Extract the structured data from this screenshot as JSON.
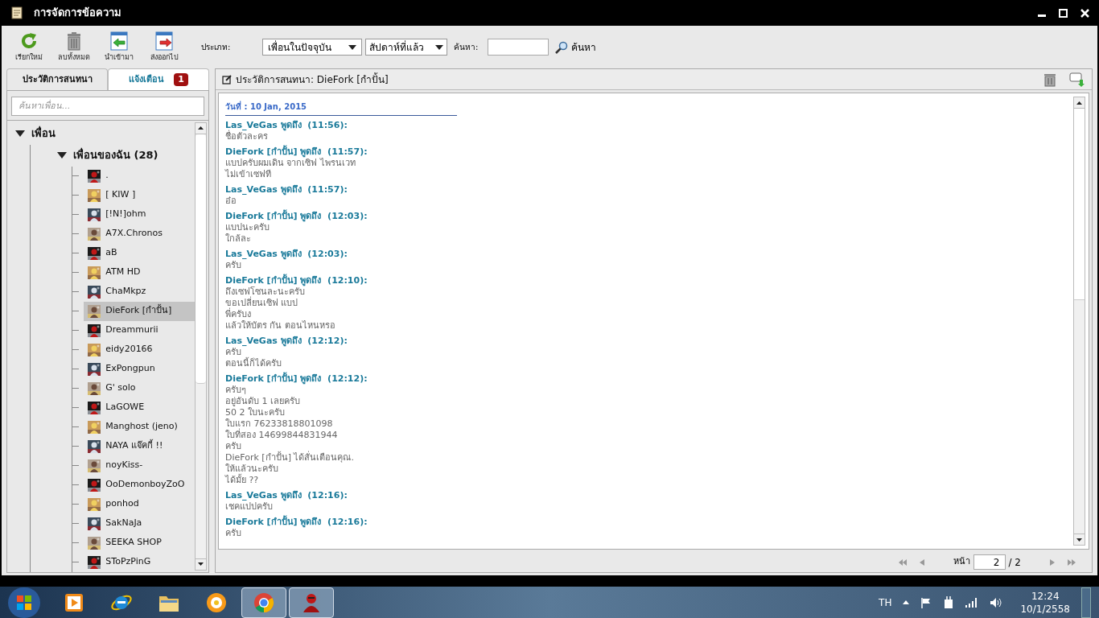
{
  "window": {
    "title": "การจัดการข้อความ"
  },
  "toolbar": {
    "buttons": [
      {
        "kind": "refresh",
        "label": "เรียกใหม่"
      },
      {
        "kind": "delete",
        "label": "ลบทั้งหมด"
      },
      {
        "kind": "import",
        "label": "นำเข้ามา"
      },
      {
        "kind": "export",
        "label": "ส่งออกไป"
      }
    ],
    "type_label": "ประเภท:",
    "type_select": "เพื่อนในปัจจุบัน",
    "period_select": "สัปดาห์ที่แล้ว",
    "search_label": "ค้นหา:",
    "search_button": "ค้นหา"
  },
  "left_tabs": [
    {
      "label": "ประวัติการสนทนา",
      "selected": true
    },
    {
      "label": "แจ้งเตือน",
      "selected": false,
      "badge": "1"
    }
  ],
  "friend_search": {
    "placeholder": "ค้นหาเพื่อน..."
  },
  "tree": [
    {
      "label": "เพื่อน",
      "expanded": true,
      "children": [
        {
          "label": "เพื่อนของฉัน (28)",
          "expanded": true,
          "children": [
            {
              "name": ".",
              "selected": false
            },
            {
              "name": "[ KIW ]",
              "selected": false
            },
            {
              "name": "[!N!]ohm",
              "selected": false
            },
            {
              "name": "A7X.Chronos",
              "selected": false
            },
            {
              "name": "aB",
              "selected": false
            },
            {
              "name": "ATM HD",
              "selected": false
            },
            {
              "name": "ChaMkpz",
              "selected": false
            },
            {
              "name": "DieFork [กำปั้น]",
              "selected": true
            },
            {
              "name": "Dreammurii",
              "selected": false
            },
            {
              "name": "eidy20166",
              "selected": false
            },
            {
              "name": "ExPongpun",
              "selected": false
            },
            {
              "name": "G' solo",
              "selected": false
            },
            {
              "name": "LaGOWE",
              "selected": false
            },
            {
              "name": "Manghost (jeno)",
              "selected": false
            },
            {
              "name": "NAYA แจ๊คกี้ !!",
              "selected": false
            },
            {
              "name": "noyKiss-",
              "selected": false
            },
            {
              "name": "OoDemonboyZoO",
              "selected": false
            },
            {
              "name": "ponhod",
              "selected": false
            },
            {
              "name": "SakNaJa",
              "selected": false
            },
            {
              "name": "SEEKA SHOP",
              "selected": false
            },
            {
              "name": "SToPzPinG",
              "selected": false
            }
          ]
        }
      ]
    }
  ],
  "chat": {
    "title": "ประวัติการสนทนา: DieFork [กำปั้น]",
    "date": "วันที่ : 10 Jan, 2015",
    "messages": [
      {
        "header": "Las_VeGas พูดถึง  (11:56):",
        "lines": [
          "ชื่อตัวละคร"
        ]
      },
      {
        "header": "DieFork [กำปั้น] พูดถึง  (11:57):",
        "lines": [
          "แบปครับผมเดิน จากเซิฟ ไพรนเวท",
          "ไม่เข้าเซฟที"
        ]
      },
      {
        "header": "Las_VeGas พูดถึง  (11:57):",
        "lines": [
          "อ๋อ"
        ]
      },
      {
        "header": "DieFork [กำปั้น] พูดถึง  (12:03):",
        "lines": [
          "แบปนะครับ",
          "ใกล้ละ"
        ]
      },
      {
        "header": "Las_VeGas พูดถึง  (12:03):",
        "lines": [
          "ครับ"
        ]
      },
      {
        "header": "DieFork [กำปั้น] พูดถึง  (12:10):",
        "lines": [
          "ถึงเซฟโซนละนะครับ",
          "ขอเปลี่ยนเซิฟ แบป",
          "พี่ครับง",
          "แล้วให้บัตร กัน ตอนไหนหรอ"
        ]
      },
      {
        "header": "Las_VeGas พูดถึง  (12:12):",
        "lines": [
          "ครับ",
          "ตอนนี้ก็ได้ครับ"
        ]
      },
      {
        "header": "DieFork [กำปั้น] พูดถึง  (12:12):",
        "lines": [
          "ครับๆ",
          "อยู่อันดับ 1 เลยครับ",
          "50 2 ใบนะครับ",
          "ใบแรก 76233818801098",
          "ใบที่สอง 14699844831944",
          "ครับ",
          "DieFork [กำปั้น] ได้สั่นเตือนคุณ.",
          "ให้แล้วนะครับ",
          "ได้มั้ย ??"
        ]
      },
      {
        "header": "Las_VeGas พูดถึง  (12:16):",
        "lines": [
          "เชคแปปครับ"
        ]
      },
      {
        "header": "DieFork [กำปั้น] พูดถึง  (12:16):",
        "lines": [
          "ครับ"
        ]
      }
    ]
  },
  "pager": {
    "label": "หน้า",
    "page": "2",
    "total": "/ 2"
  },
  "taskbar": {
    "apps": [
      {
        "kind": "media",
        "running": false
      },
      {
        "kind": "browser-e",
        "running": false
      },
      {
        "kind": "folder",
        "running": false
      },
      {
        "kind": "orange",
        "running": false
      },
      {
        "kind": "chrome",
        "running": true
      },
      {
        "kind": "app",
        "running": true
      }
    ],
    "language": "TH",
    "time": "12:24",
    "date": "10/1/2558"
  }
}
